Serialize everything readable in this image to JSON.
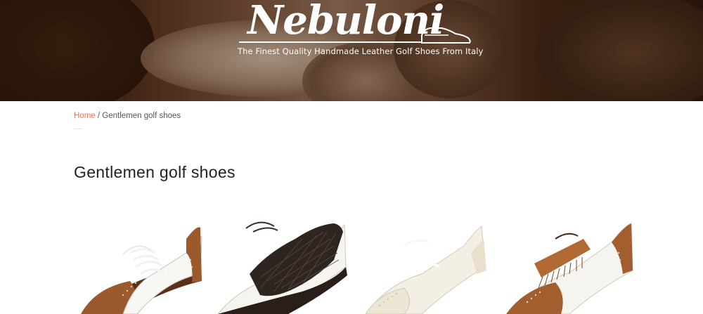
{
  "brand": {
    "name": "Nebuloni",
    "tagline": "The Finest Quality Handmade Leather Golf Shoes From Italy"
  },
  "breadcrumb": {
    "home": "Home",
    "separator": " / ",
    "current": "Gentlemen golf shoes"
  },
  "page": {
    "title": "Gentlemen golf shoes"
  },
  "products": [
    {
      "image": "brown-white-brogue-golf-shoe"
    },
    {
      "image": "black-woven-white-saddle-golf-shoe"
    },
    {
      "image": "white-wingtip-golf-shoe"
    },
    {
      "image": "brown-white-kiltie-golf-shoe"
    }
  ],
  "colors": {
    "accent_link": "#e0795a",
    "text": "#222222",
    "hero_brown": "#4a2a18"
  }
}
